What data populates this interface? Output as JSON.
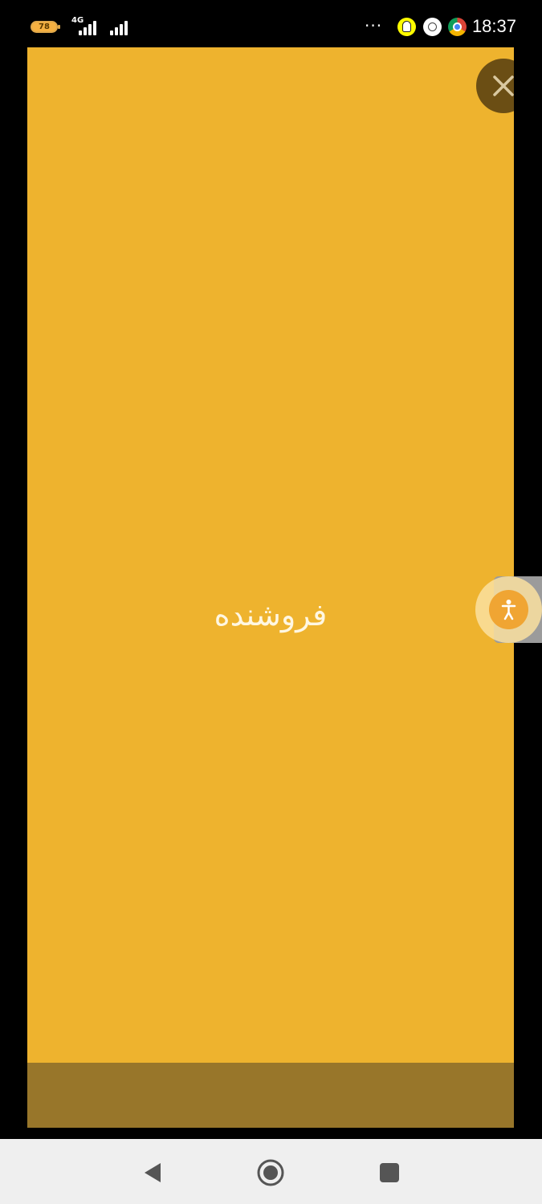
{
  "status_bar": {
    "battery_level": "78",
    "network_type": "4G",
    "overflow_dots": "···",
    "notification_icons": [
      "snapchat-icon",
      "sync-icon",
      "chrome-icon"
    ],
    "time": "18:37"
  },
  "app": {
    "title": "فروشنده",
    "background_color": "#eeb32e",
    "footer_color": "#98762a",
    "close_icon": "close-icon",
    "accessibility_icon": "accessibility-icon"
  },
  "nav_bar": {
    "icons": [
      "back-icon",
      "home-icon",
      "recents-icon"
    ]
  }
}
